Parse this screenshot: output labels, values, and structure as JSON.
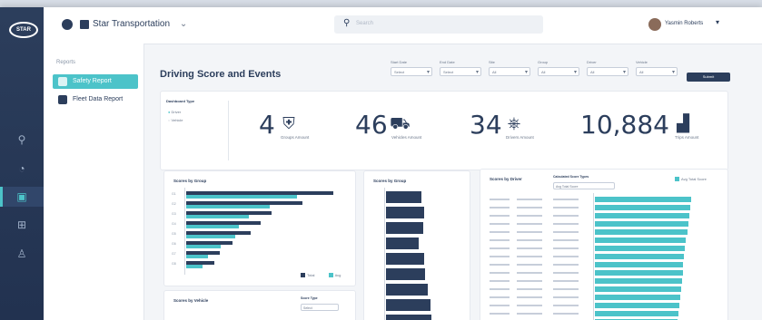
{
  "app": {
    "brand": "Star Transportation",
    "search_placeholder": "Search",
    "user_name": "Yasmin Roberts"
  },
  "sidebar": {
    "section": "Reports",
    "items": [
      {
        "label": "Safety Report",
        "active": true
      },
      {
        "label": "Fleet Data Report",
        "active": false
      }
    ]
  },
  "main": {
    "title": "Driving Score and Events",
    "filters": [
      {
        "label": "Start Date",
        "value": "Select"
      },
      {
        "label": "End Date",
        "value": "Select"
      },
      {
        "label": "Site",
        "value": "All"
      },
      {
        "label": "Group",
        "value": "All"
      },
      {
        "label": "Driver",
        "value": "All"
      },
      {
        "label": "Vehicle",
        "value": "All"
      }
    ],
    "submit_label": "Submit",
    "summary": {
      "type_title": "Dashboard Type",
      "options": [
        "Driver",
        "Vehicle"
      ],
      "stats": [
        {
          "value": "4",
          "label": "Groups Amount",
          "icon": "shield-icon"
        },
        {
          "value": "46",
          "label": "Vehicles Amount",
          "icon": "car-icon"
        },
        {
          "value": "34",
          "label": "Drivers Amount",
          "icon": "steering-wheel-icon"
        },
        {
          "value": "10,884",
          "label": "Trips Amount",
          "icon": "chart-icon"
        }
      ]
    },
    "panels": {
      "left_title": "Scores by Group",
      "middle_title": "Scores by Group",
      "right_title": "Scores by Driver",
      "right_dropdown_label": "Calculated Score Types",
      "right_dropdown_value": "Avg Total Score",
      "right_legend": "Avg Total Score",
      "bottom_left_title": "Scores by Vehicle",
      "bottom_left_dropdown_label": "Score Type",
      "bottom_left_dropdown_value": "Select"
    }
  },
  "chart_data": [
    {
      "type": "bar",
      "orientation": "horizontal",
      "series": [
        {
          "name": "Total",
          "values": [
            0.95,
            0.75,
            0.55,
            0.48,
            0.42,
            0.3,
            0.22,
            0.18
          ]
        },
        {
          "name": "Avg",
          "values": [
            0.8,
            0.6,
            0.45,
            0.38,
            0.35,
            0.25,
            0.16,
            0.12
          ]
        }
      ],
      "categories": [
        "G1",
        "G2",
        "G3",
        "G4",
        "G5",
        "G6",
        "G7",
        "G8"
      ]
    },
    {
      "type": "bar",
      "orientation": "horizontal",
      "values": [
        0.55,
        0.6,
        0.58,
        0.52,
        0.6,
        0.62,
        0.65,
        0.7,
        0.72
      ]
    },
    {
      "type": "bar",
      "orientation": "horizontal",
      "values": [
        0.98,
        0.97,
        0.96,
        0.95,
        0.94,
        0.93,
        0.92,
        0.91,
        0.9,
        0.9,
        0.89,
        0.88,
        0.87,
        0.86,
        0.85,
        0.84
      ]
    }
  ],
  "colors": {
    "navy": "#2c3e5c",
    "teal": "#4cc3c9",
    "rail": "#223250"
  }
}
